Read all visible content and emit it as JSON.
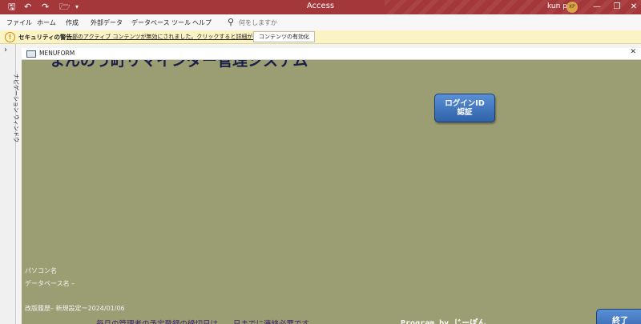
{
  "window": {
    "app_title": "Access",
    "user_name": "kun p",
    "user_initials": "KP",
    "quick_access": [
      "save-icon",
      "undo-icon",
      "redo-icon",
      "open-icon",
      "customize-icon"
    ],
    "controls": [
      "minimize-icon",
      "restore-icon",
      "close-icon"
    ]
  },
  "ribbon": {
    "tabs": [
      "ファイル",
      "ホーム",
      "作成",
      "外部データ",
      "データベース ツール",
      "ヘルプ"
    ],
    "search_placeholder": "何をしますか"
  },
  "message_bar": {
    "title": "セキュリティの警告",
    "text": "一部のアクティブ コンテンツが無効にされました。クリックすると詳細が表示されます。",
    "button": "コンテンツの有効化"
  },
  "nav_pane": {
    "label": "ナビゲーション ウィンドウ"
  },
  "form": {
    "tab_title": "MENUFORM",
    "header_text": "まんのう町リマインダー管理システム",
    "login_button": "ログインID\n認証",
    "pc_label": "パソコン名",
    "db_label": "データベース名 –",
    "revision": "改版履歴– 新規設定ー2024/01/06",
    "notice": "毎月の管理者の予定登録の締切日は　　日までに連絡必要です。",
    "credit": "Program by じーぽん",
    "exit_button": "終了"
  },
  "colors": {
    "titlebar": "#a4373a",
    "form_background": "#9b9e72",
    "button_blue": "#3a6fba",
    "warning_bar": "#fcf3c4"
  }
}
